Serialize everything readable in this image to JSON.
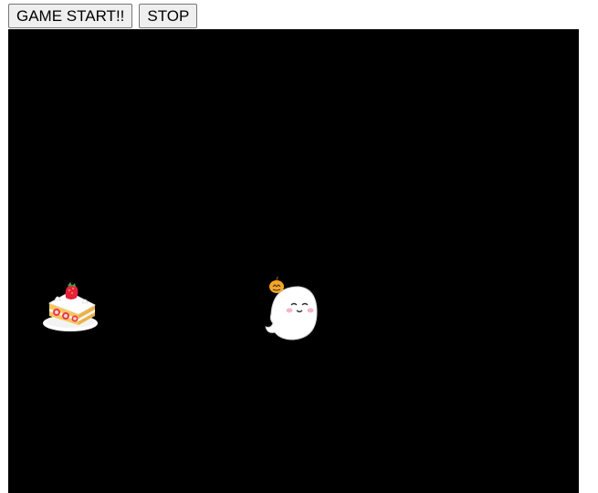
{
  "controls": {
    "start_label": "GAME START!!",
    "stop_label": "STOP"
  },
  "game": {
    "background_color": "#000000",
    "sprites": [
      {
        "name": "cake",
        "icon": "strawberry-shortcake-icon"
      },
      {
        "name": "ghost",
        "icon": "ghost-with-pumpkin-icon"
      }
    ]
  }
}
